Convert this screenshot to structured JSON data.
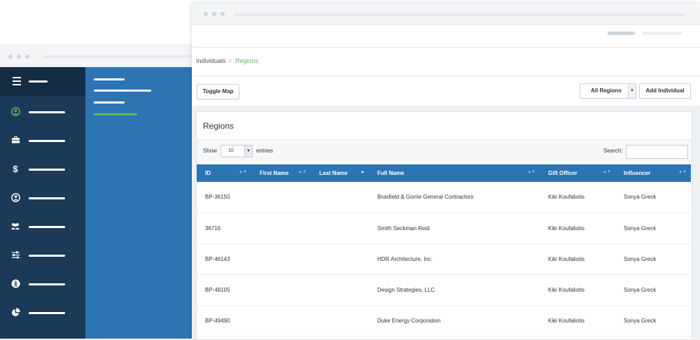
{
  "breadcrumb": {
    "parent": "Individuals",
    "separator": "//",
    "current": "Regions"
  },
  "toolbar": {
    "toggle_map": "Toggle Map",
    "region_select": "All Regions",
    "add_individual": "Add Individual"
  },
  "panel": {
    "title": "Regions",
    "show_label": "Show",
    "page_length": "10",
    "entries_label": "entries",
    "search_label": "Search:",
    "search_value": ""
  },
  "table": {
    "columns": [
      "ID",
      "First Name",
      "Last Name",
      "Full Name",
      "Gift Officer",
      "Influencer"
    ],
    "rows": [
      [
        "BP-36150",
        "",
        "",
        "Brasfield & Gorrie General Contractors",
        "Kiki Koufaliotis",
        "Sonya Greck"
      ],
      [
        "36716",
        "",
        "",
        "Smith Seckman Reid",
        "Kiki Koufaliotis",
        "Sonya Greck"
      ],
      [
        "BP-46143",
        "",
        "",
        "HDR Architecture, Inc.",
        "Kiki Koufaliotis",
        "Sonya Greck"
      ],
      [
        "BP-48105",
        "",
        "",
        "Design Strategies, LLC",
        "Kiki Koufaliotis",
        "Sonya Greck"
      ],
      [
        "BP-49490",
        "",
        "",
        "Duke Energy Corporation",
        "Kiki Koufaliotis",
        "Sonya Greck"
      ]
    ]
  },
  "sidebar": {
    "icons": [
      "user-circle-icon",
      "briefcase-icon",
      "dollar-icon",
      "person-icon",
      "group-icon",
      "sliders-icon",
      "accessibility-icon",
      "pie-chart-icon"
    ]
  },
  "colors": {
    "sidebar_dark": "#1b3a58",
    "sidebar_blue": "#2d74b3",
    "accent_green": "#5cb85c",
    "table_header": "#2d74b3"
  }
}
